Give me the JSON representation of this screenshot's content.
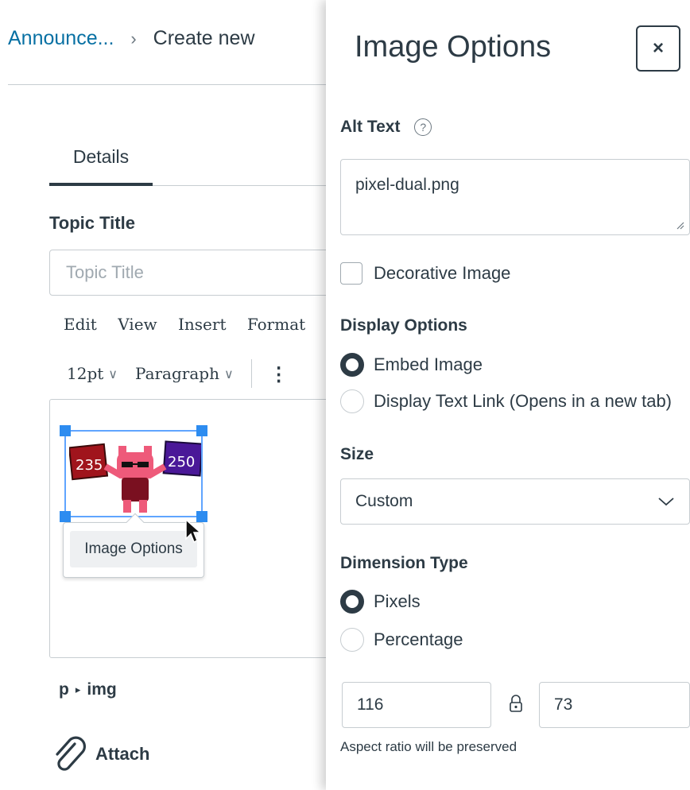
{
  "breadcrumb": {
    "parent": "Announce...",
    "current": "Create new"
  },
  "tabs": {
    "details": "Details"
  },
  "topic": {
    "label": "Topic Title",
    "placeholder": "Topic Title"
  },
  "menubar": {
    "edit": "Edit",
    "view": "View",
    "insert": "Insert",
    "format": "Format"
  },
  "toolbar": {
    "font_size": "12pt",
    "block": "Paragraph"
  },
  "editor": {
    "image": {
      "left_number": "235",
      "right_number": "250"
    },
    "popup_label": "Image Options",
    "path": {
      "p": "p",
      "arrow": "▸",
      "img": "img"
    }
  },
  "attach": {
    "label": "Attach"
  },
  "tray": {
    "title": "Image Options",
    "close": "×",
    "alt_text": {
      "label": "Alt Text",
      "help": "?",
      "value": "pixel-dual.png"
    },
    "decorative": {
      "label": "Decorative Image",
      "checked": false
    },
    "display_options": {
      "label": "Display Options",
      "embed": "Embed Image",
      "link": "Display Text Link (Opens in a new tab)",
      "selected": "embed"
    },
    "size": {
      "label": "Size",
      "value": "Custom"
    },
    "dimension_type": {
      "label": "Dimension Type",
      "pixels": "Pixels",
      "percentage": "Percentage",
      "selected": "pixels"
    },
    "dimensions": {
      "width": "116",
      "height": "73"
    },
    "hint": "Aspect ratio will be preserved"
  },
  "colors": {
    "link": "#0770a3",
    "text": "#2d3b45",
    "handle": "#2d8cf0",
    "border": "#c7cdd1"
  }
}
